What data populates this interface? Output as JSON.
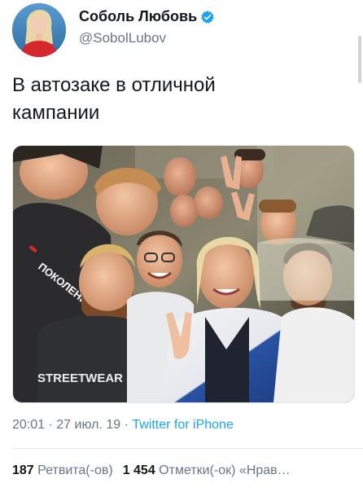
{
  "author": {
    "display_name": "Соболь Любовь",
    "handle": "@SobolLubov",
    "verified": true
  },
  "tweet": {
    "text_line1": "В автозаке в отличной",
    "text_line2": "кампании"
  },
  "photo_caption": {
    "shirt_text_1": "ПОКОЛЕНИЕ",
    "shirt_text_2": "STREETWEAR"
  },
  "meta": {
    "time": "20:01",
    "separator1": " · ",
    "date": "27 июл. 19",
    "separator2": " · ",
    "source": "Twitter for iPhone"
  },
  "stats": {
    "retweets_count": "187",
    "retweets_label": " Ретвита(-ов)",
    "likes_count": "1 454",
    "likes_label": " Отметки(-ок) «Нрав…"
  },
  "colors": {
    "link": "#1da1f2",
    "secondary_text": "#657786",
    "primary_text": "#14171a",
    "verified_badge": "#1da1f2"
  }
}
